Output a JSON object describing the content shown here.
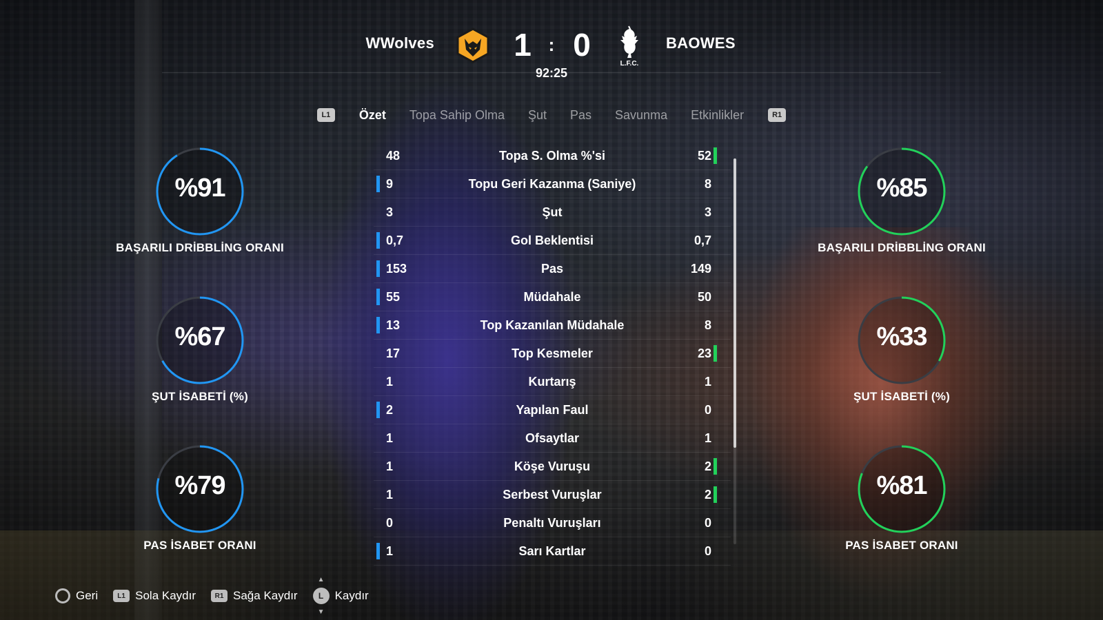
{
  "match": {
    "home_team": "WWolves",
    "away_team": "BAOWES",
    "home_score": "1",
    "separator": ":",
    "away_score": "0",
    "clock": "92:25",
    "away_crest_text": "L.F.C."
  },
  "tabs": {
    "left_shoulder": "L1",
    "right_shoulder": "R1",
    "items": [
      {
        "label": "Özet",
        "active": true
      },
      {
        "label": "Topa Sahip Olma",
        "active": false
      },
      {
        "label": "Şut",
        "active": false
      },
      {
        "label": "Pas",
        "active": false
      },
      {
        "label": "Savunma",
        "active": false
      },
      {
        "label": "Etkinlikler",
        "active": false
      }
    ]
  },
  "stats": [
    {
      "label": "Topa S. Olma %'si",
      "home": "48",
      "away": "52",
      "leader": "away"
    },
    {
      "label": "Topu Geri Kazanma (Saniye)",
      "home": "9",
      "away": "8",
      "leader": "home"
    },
    {
      "label": "Şut",
      "home": "3",
      "away": "3",
      "leader": "none"
    },
    {
      "label": "Gol Beklentisi",
      "home": "0,7",
      "away": "0,7",
      "leader": "home"
    },
    {
      "label": "Pas",
      "home": "153",
      "away": "149",
      "leader": "home"
    },
    {
      "label": "Müdahale",
      "home": "55",
      "away": "50",
      "leader": "home"
    },
    {
      "label": "Top Kazanılan Müdahale",
      "home": "13",
      "away": "8",
      "leader": "home"
    },
    {
      "label": "Top Kesmeler",
      "home": "17",
      "away": "23",
      "leader": "away"
    },
    {
      "label": "Kurtarış",
      "home": "1",
      "away": "1",
      "leader": "none"
    },
    {
      "label": "Yapılan Faul",
      "home": "2",
      "away": "0",
      "leader": "home"
    },
    {
      "label": "Ofsaytlar",
      "home": "1",
      "away": "1",
      "leader": "none"
    },
    {
      "label": "Köşe Vuruşu",
      "home": "1",
      "away": "2",
      "leader": "away"
    },
    {
      "label": "Serbest Vuruşlar",
      "home": "1",
      "away": "2",
      "leader": "away"
    },
    {
      "label": "Penaltı Vuruşları",
      "home": "0",
      "away": "0",
      "leader": "none"
    },
    {
      "label": "Sarı Kartlar",
      "home": "1",
      "away": "0",
      "leader": "home"
    }
  ],
  "rings": {
    "home": [
      {
        "pct_text": "%91",
        "value": 0.91,
        "label": "BAŞARILI DRİBBLİNG ORANI"
      },
      {
        "pct_text": "%67",
        "value": 0.67,
        "label": "ŞUT İSABETİ (%)"
      },
      {
        "pct_text": "%79",
        "value": 0.79,
        "label": "PAS İSABET ORANI"
      }
    ],
    "away": [
      {
        "pct_text": "%85",
        "value": 0.85,
        "label": "BAŞARILI DRİBBLİNG ORANI"
      },
      {
        "pct_text": "%33",
        "value": 0.33,
        "label": "ŞUT İSABETİ (%)"
      },
      {
        "pct_text": "%81",
        "value": 0.81,
        "label": "PAS İSABET ORANI"
      }
    ]
  },
  "colors": {
    "home_accent": "#2196f3",
    "away_accent": "#22d15a",
    "ring_track": "#3a3d44"
  },
  "footer": {
    "back": "Geri",
    "scroll_left": "Sola Kaydır",
    "scroll_right": "Sağa Kaydır",
    "scroll": "Kaydır",
    "l1": "L1",
    "r1": "R1",
    "l": "L"
  }
}
